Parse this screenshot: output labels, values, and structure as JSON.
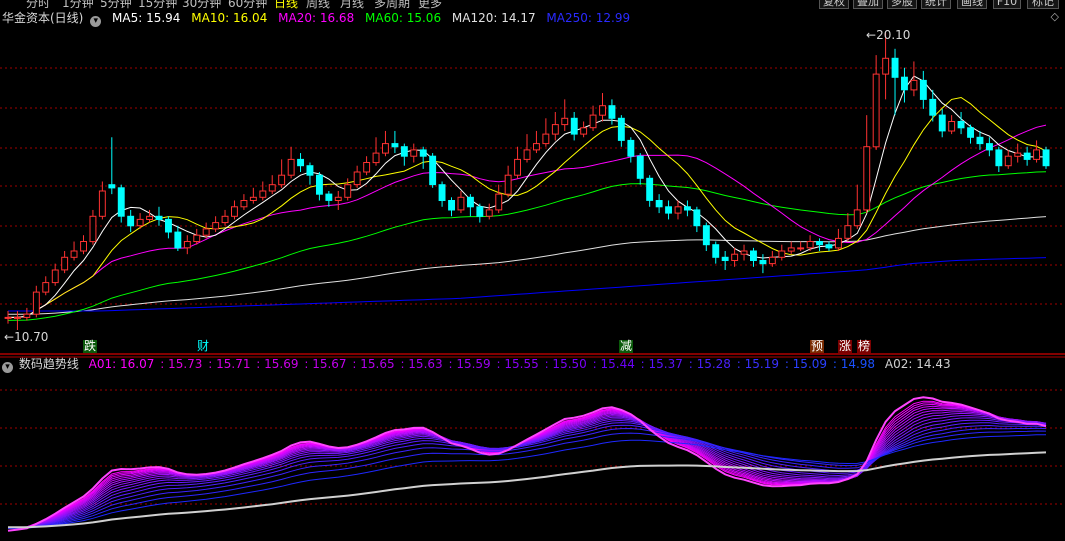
{
  "toolbar": {
    "periods": [
      "分时",
      "1分钟",
      "5分钟",
      "15分钟",
      "30分钟",
      "60分钟",
      "日线",
      "周线",
      "月线",
      "多周期",
      "更多"
    ],
    "active_period": "日线",
    "buttons": [
      "复权",
      "叠加",
      "多股",
      "统计",
      "画线",
      "F10",
      "标记"
    ]
  },
  "main_legend": {
    "title": "华金资本(日线)",
    "items": [
      {
        "label": "MA5: 15.94",
        "color": "#ffffff"
      },
      {
        "label": "MA10: 16.04",
        "color": "#ffff00"
      },
      {
        "label": "MA20: 16.68",
        "color": "#ff00ff"
      },
      {
        "label": "MA60: 15.06",
        "color": "#00ff00"
      },
      {
        "label": "MA120: 14.17",
        "color": "#e0e0e0"
      },
      {
        "label": "MA250: 12.99",
        "color": "#0000ff"
      }
    ]
  },
  "price_labels": {
    "high": "20.10",
    "low": "10.70"
  },
  "event_markers": [
    {
      "text": "跌",
      "bg": "#0a5a0a",
      "color": "#ffffff"
    },
    {
      "text": "财",
      "bg": "#000000",
      "color": "#00ffff"
    },
    {
      "text": "减",
      "bg": "#0a5a0a",
      "color": "#ffffff"
    },
    {
      "text": "预",
      "bg": "#7a2a00",
      "color": "#ffffff"
    },
    {
      "text": "涨",
      "bg": "#7a0000",
      "color": "#ffffff"
    },
    {
      "text": "榜",
      "bg": "#7a0000",
      "color": "#ffffff"
    }
  ],
  "indicator_legend": {
    "title": "数码趋势线",
    "a01_label": "A01: 16.07",
    "a01_values": [
      ": 15.73",
      ": 15.71",
      ": 15.69",
      ": 15.67",
      ": 15.65",
      ": 15.63",
      ": 15.59",
      ": 15.55",
      ": 15.50",
      ": 15.44",
      ": 15.37",
      ": 15.28",
      ": 15.19",
      ": 15.09",
      ": 14.98"
    ],
    "a02_label": "A02: 14.43"
  },
  "colors": {
    "up": "#ff3232",
    "down": "#00ffff",
    "ma5": "#ffffff",
    "ma10": "#ffff00",
    "ma20": "#ff00ff",
    "ma60": "#00ff00",
    "ma120": "#e0e0e0",
    "ma250": "#0000ff",
    "grid": "#a00000",
    "a02": "#d0d0d0"
  },
  "chart_data": {
    "type": "candlestick",
    "price_high": 20.1,
    "price_low": 10.7,
    "candles": [
      [
        11.1,
        11.1,
        11.3,
        10.9
      ],
      [
        11.1,
        11.1,
        11.3,
        10.7
      ],
      [
        11.1,
        11.2,
        11.4,
        11.0
      ],
      [
        11.2,
        11.9,
        12.1,
        11.1
      ],
      [
        11.9,
        12.2,
        12.4,
        11.8
      ],
      [
        12.2,
        12.6,
        12.8,
        12.1
      ],
      [
        12.6,
        13.0,
        13.2,
        12.5
      ],
      [
        13.0,
        13.2,
        13.5,
        12.9
      ],
      [
        13.2,
        13.5,
        13.7,
        13.1
      ],
      [
        13.5,
        14.3,
        14.5,
        13.4
      ],
      [
        14.3,
        15.1,
        15.4,
        14.2
      ],
      [
        15.3,
        15.2,
        16.8,
        15.0
      ],
      [
        15.2,
        14.3,
        15.3,
        14.1
      ],
      [
        14.3,
        14.0,
        14.5,
        13.8
      ],
      [
        14.0,
        14.2,
        14.4,
        13.9
      ],
      [
        14.2,
        14.3,
        14.5,
        14.1
      ],
      [
        14.3,
        14.2,
        14.6,
        14.0
      ],
      [
        14.2,
        13.8,
        14.3,
        13.6
      ],
      [
        13.8,
        13.3,
        14.0,
        13.2
      ],
      [
        13.3,
        13.5,
        13.7,
        13.1
      ],
      [
        13.5,
        13.7,
        13.9,
        13.4
      ],
      [
        13.7,
        13.9,
        14.1,
        13.6
      ],
      [
        13.9,
        14.1,
        14.3,
        13.8
      ],
      [
        14.1,
        14.3,
        14.5,
        14.0
      ],
      [
        14.3,
        14.6,
        14.8,
        14.2
      ],
      [
        14.6,
        14.8,
        15.0,
        14.5
      ],
      [
        14.8,
        14.9,
        15.2,
        14.7
      ],
      [
        14.9,
        15.1,
        15.4,
        14.8
      ],
      [
        15.1,
        15.3,
        15.6,
        15.0
      ],
      [
        15.3,
        15.6,
        16.1,
        15.2
      ],
      [
        15.6,
        16.1,
        16.5,
        15.5
      ],
      [
        16.1,
        15.9,
        16.3,
        15.7
      ],
      [
        15.9,
        15.6,
        16.0,
        15.3
      ],
      [
        15.6,
        15.0,
        15.7,
        14.8
      ],
      [
        15.0,
        14.8,
        15.1,
        14.6
      ],
      [
        14.8,
        14.9,
        15.1,
        14.5
      ],
      [
        14.9,
        15.3,
        15.5,
        14.8
      ],
      [
        15.3,
        15.7,
        15.9,
        15.2
      ],
      [
        15.7,
        16.0,
        16.2,
        15.6
      ],
      [
        16.0,
        16.3,
        16.8,
        15.9
      ],
      [
        16.3,
        16.6,
        17.0,
        16.2
      ],
      [
        16.6,
        16.5,
        17.0,
        16.3
      ],
      [
        16.5,
        16.2,
        16.6,
        15.9
      ],
      [
        16.2,
        16.4,
        16.6,
        16.0
      ],
      [
        16.4,
        16.2,
        16.5,
        15.8
      ],
      [
        16.2,
        15.3,
        16.3,
        15.2
      ],
      [
        15.3,
        14.8,
        15.4,
        14.6
      ],
      [
        14.8,
        14.5,
        14.9,
        14.3
      ],
      [
        14.5,
        14.9,
        15.1,
        14.4
      ],
      [
        14.9,
        14.6,
        15.0,
        14.3
      ],
      [
        14.6,
        14.3,
        14.7,
        14.1
      ],
      [
        14.3,
        14.5,
        14.7,
        14.2
      ],
      [
        14.5,
        15.0,
        15.3,
        14.4
      ],
      [
        15.0,
        15.6,
        15.9,
        14.9
      ],
      [
        15.6,
        16.1,
        16.5,
        15.5
      ],
      [
        16.1,
        16.4,
        16.9,
        16.0
      ],
      [
        16.4,
        16.6,
        17.0,
        16.3
      ],
      [
        16.6,
        16.9,
        17.4,
        16.5
      ],
      [
        16.9,
        17.2,
        17.6,
        16.7
      ],
      [
        17.2,
        17.4,
        18.0,
        17.0
      ],
      [
        17.4,
        16.9,
        17.6,
        16.7
      ],
      [
        16.9,
        17.1,
        17.3,
        16.8
      ],
      [
        17.1,
        17.5,
        17.8,
        17.0
      ],
      [
        17.5,
        17.8,
        18.2,
        17.3
      ],
      [
        17.8,
        17.4,
        18.0,
        17.2
      ],
      [
        17.4,
        16.7,
        17.5,
        16.5
      ],
      [
        16.7,
        16.2,
        16.8,
        16.0
      ],
      [
        16.2,
        15.5,
        16.3,
        15.3
      ],
      [
        15.5,
        14.8,
        15.6,
        14.6
      ],
      [
        14.8,
        14.6,
        15.0,
        14.4
      ],
      [
        14.6,
        14.4,
        14.8,
        14.2
      ],
      [
        14.4,
        14.6,
        14.8,
        14.2
      ],
      [
        14.6,
        14.5,
        14.8,
        14.3
      ],
      [
        14.5,
        14.0,
        14.6,
        13.8
      ],
      [
        14.0,
        13.4,
        14.1,
        13.2
      ],
      [
        13.4,
        13.0,
        13.5,
        12.8
      ],
      [
        13.0,
        12.9,
        13.2,
        12.6
      ],
      [
        12.9,
        13.1,
        13.3,
        12.7
      ],
      [
        13.1,
        13.2,
        13.4,
        12.9
      ],
      [
        13.2,
        12.9,
        13.3,
        12.7
      ],
      [
        12.9,
        12.8,
        13.1,
        12.5
      ],
      [
        12.8,
        13.0,
        13.2,
        12.7
      ],
      [
        13.0,
        13.2,
        13.4,
        12.9
      ],
      [
        13.2,
        13.3,
        13.5,
        13.1
      ],
      [
        13.3,
        13.3,
        13.5,
        13.2
      ],
      [
        13.3,
        13.5,
        13.7,
        13.2
      ],
      [
        13.5,
        13.4,
        13.6,
        13.2
      ],
      [
        13.4,
        13.3,
        13.5,
        13.2
      ],
      [
        13.3,
        13.6,
        13.9,
        13.2
      ],
      [
        13.6,
        14.0,
        14.4,
        13.5
      ],
      [
        14.0,
        14.5,
        15.3,
        13.9
      ],
      [
        14.5,
        16.5,
        17.5,
        14.4
      ],
      [
        16.5,
        18.8,
        19.4,
        16.4
      ],
      [
        18.8,
        19.3,
        20.1,
        18.0
      ],
      [
        19.3,
        18.7,
        19.6,
        17.5
      ],
      [
        18.7,
        18.3,
        19.0,
        17.9
      ],
      [
        18.3,
        18.6,
        19.2,
        18.1
      ],
      [
        18.6,
        18.0,
        18.9,
        17.7
      ],
      [
        18.0,
        17.5,
        18.3,
        17.3
      ],
      [
        17.5,
        17.0,
        17.7,
        16.8
      ],
      [
        17.0,
        17.3,
        17.5,
        16.9
      ],
      [
        17.3,
        17.1,
        17.6,
        16.9
      ],
      [
        17.1,
        16.8,
        17.2,
        16.6
      ],
      [
        16.8,
        16.6,
        17.0,
        16.4
      ],
      [
        16.6,
        16.4,
        16.8,
        16.2
      ],
      [
        16.4,
        15.9,
        16.5,
        15.7
      ],
      [
        15.9,
        16.2,
        16.4,
        15.8
      ],
      [
        16.2,
        16.3,
        16.6,
        16.0
      ],
      [
        16.3,
        16.1,
        16.5,
        15.9
      ],
      [
        16.1,
        16.4,
        16.7,
        16.0
      ],
      [
        16.4,
        15.9,
        16.5,
        15.8
      ]
    ],
    "ma250": [
      11.3,
      11.3,
      11.3,
      11.35,
      11.4,
      11.45,
      11.5,
      11.55,
      11.6,
      11.65,
      11.7,
      11.8,
      11.9,
      12.0,
      12.1,
      12.2,
      12.3,
      12.4,
      12.5,
      12.6,
      12.8,
      12.9,
      12.95,
      12.99
    ]
  }
}
